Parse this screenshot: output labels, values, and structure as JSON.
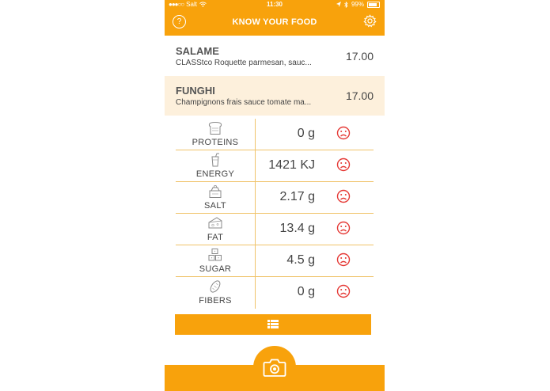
{
  "status_bar": {
    "carrier": "Salt",
    "time": "11:30",
    "battery": "99%"
  },
  "header": {
    "title": "KNOW YOUR FOOD",
    "help_label": "?"
  },
  "products": [
    {
      "name": "SALAME",
      "description": "CLASStco  Roquette  parmesan, sauc...",
      "price": "17.00",
      "selected": false
    },
    {
      "name": "FUNGHI",
      "description": "Champignons frais  sauce tomate  ma...",
      "price": "17.00",
      "selected": true
    }
  ],
  "nutrition": [
    {
      "label": "PROTEINS",
      "value": "0 g",
      "icon": "bread-icon",
      "rating": "sad-face-icon"
    },
    {
      "label": "ENERGY",
      "value": "1421 KJ",
      "icon": "drink-cup-icon",
      "rating": "sad-face-icon"
    },
    {
      "label": "SALT",
      "value": "2.17 g",
      "icon": "salt-jar-icon",
      "rating": "sad-face-icon"
    },
    {
      "label": "FAT",
      "value": "13.4 g",
      "icon": "cheese-icon",
      "rating": "sad-face-icon"
    },
    {
      "label": "SUGAR",
      "value": "4.5 g",
      "icon": "sugar-cubes-icon",
      "rating": "sad-face-icon"
    },
    {
      "label": "FIBERS",
      "value": "0 g",
      "icon": "grain-icon",
      "rating": "sad-face-icon"
    }
  ],
  "colors": {
    "accent": "#f8a20c",
    "selected_row": "#fdf0dc",
    "divider": "#f0c36a",
    "sad_face": "#e53935"
  },
  "icons": {
    "list_button": "list-icon",
    "camera_button": "camera-icon",
    "settings": "gear-icon",
    "help": "help-icon"
  }
}
